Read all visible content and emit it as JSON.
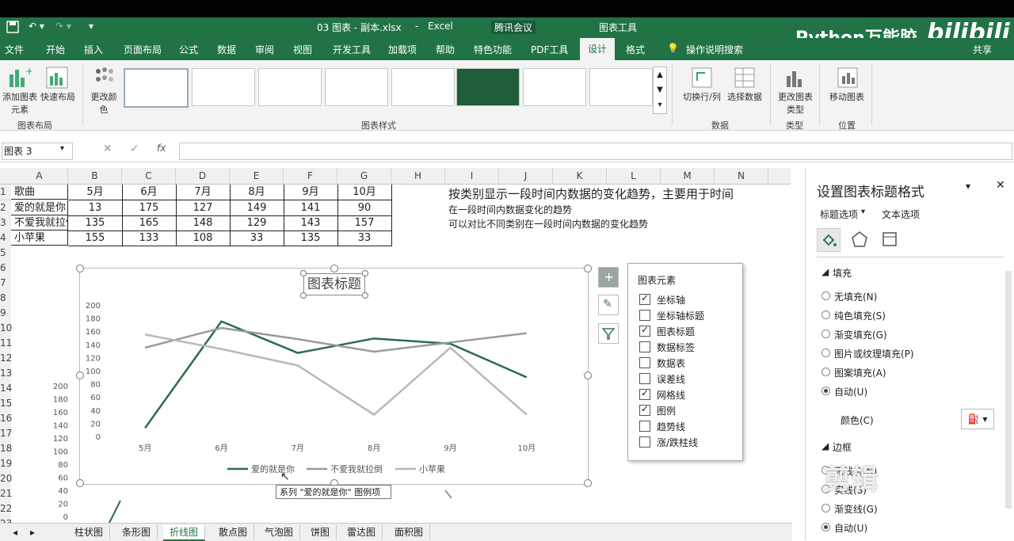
{
  "titlebar": {
    "filename": "03 图表 - 副本.xlsx",
    "app": "Excel",
    "meeting": "腾讯会议",
    "context_tab": "图表工具",
    "share": "共享"
  },
  "watermark": {
    "channel": "Python万能胶",
    "brand": "bilibili",
    "editor": "剪辑"
  },
  "ribbon_tabs": [
    "文件",
    "开始",
    "插入",
    "页面布局",
    "公式",
    "数据",
    "审阅",
    "视图",
    "开发工具",
    "加载项",
    "帮助",
    "特色功能",
    "PDF工具",
    "设计",
    "格式"
  ],
  "active_tab": "设计",
  "search_label": "操作说明搜索",
  "ribbon": {
    "add_element": "添加图表元素",
    "quick_layout": "快速布局",
    "group_layout": "图表布局",
    "change_colors": "更改颜色",
    "group_styles": "图表样式",
    "switch_rowcol": "切换行/列",
    "select_data": "选择数据",
    "group_data": "数据",
    "change_type": "更改图表类型",
    "group_type": "类型",
    "move_chart": "移动图表",
    "group_location": "位置"
  },
  "namebox": "图表 3",
  "fx": "fx",
  "columns": [
    "A",
    "B",
    "C",
    "D",
    "E",
    "F",
    "G",
    "H",
    "I",
    "J",
    "K",
    "L",
    "M",
    "N"
  ],
  "rows": [
    "1",
    "2",
    "3",
    "4",
    "5",
    "6",
    "7",
    "8",
    "9",
    "10",
    "11",
    "12",
    "13",
    "14",
    "15",
    "16",
    "17",
    "18",
    "19",
    "20",
    "21",
    "22",
    "23"
  ],
  "table": {
    "header": [
      "歌曲",
      "5月",
      "6月",
      "7月",
      "8月",
      "9月",
      "10月"
    ],
    "rows": [
      [
        "爱的就是你",
        "13",
        "175",
        "127",
        "149",
        "141",
        "90"
      ],
      [
        "不爱我就拉倒",
        "135",
        "165",
        "148",
        "129",
        "143",
        "157"
      ],
      [
        "小苹果",
        "155",
        "133",
        "108",
        "33",
        "135",
        "33"
      ]
    ]
  },
  "notes": [
    "按类别显示一段时间内数据的变化趋势，主要用于时间",
    "在一段时间内数据变化的趋势",
    "可以对比不同类别在一段时间内数据的变化趋势"
  ],
  "chart_data": {
    "type": "line",
    "title": "图表标题",
    "categories": [
      "5月",
      "6月",
      "7月",
      "8月",
      "9月",
      "10月"
    ],
    "ylim": [
      0,
      200
    ],
    "yticks": [
      "0",
      "20",
      "40",
      "60",
      "80",
      "100",
      "120",
      "140",
      "160",
      "180",
      "200"
    ],
    "grid": false,
    "legend": "bottom",
    "series": [
      {
        "name": "爱的就是你",
        "values": [
          13,
          175,
          127,
          149,
          141,
          90
        ],
        "color": "#2e6b47"
      },
      {
        "name": "不爱我就拉倒",
        "values": [
          135,
          165,
          148,
          129,
          143,
          157
        ],
        "color": "#9a9a9a"
      },
      {
        "name": "小苹果",
        "values": [
          155,
          133,
          108,
          33,
          135,
          33
        ],
        "color": "#b8b8b8"
      }
    ]
  },
  "behind_chart_yticks": [
    "0",
    "20",
    "40",
    "60",
    "80",
    "100",
    "120",
    "140",
    "160",
    "180",
    "200"
  ],
  "chart_elements": {
    "title": "图表元素",
    "items": [
      {
        "label": "坐标轴",
        "checked": true
      },
      {
        "label": "坐标轴标题",
        "checked": false
      },
      {
        "label": "图表标题",
        "checked": true
      },
      {
        "label": "数据标签",
        "checked": false
      },
      {
        "label": "数据表",
        "checked": false
      },
      {
        "label": "误差线",
        "checked": false
      },
      {
        "label": "网格线",
        "checked": true
      },
      {
        "label": "图例",
        "checked": true
      },
      {
        "label": "趋势线",
        "checked": false
      },
      {
        "label": "涨/跌柱线",
        "checked": false
      }
    ]
  },
  "tooltip": "系列 \"爱的就是你\" 图例项",
  "pane": {
    "title": "设置图表标题格式",
    "tab_title_options": "标题选项",
    "tab_text_options": "文本选项",
    "fill_section": "填充",
    "fill_options": [
      {
        "label": "无填充(N)",
        "selected": false
      },
      {
        "label": "纯色填充(S)",
        "selected": false
      },
      {
        "label": "渐变填充(G)",
        "selected": false
      },
      {
        "label": "图片或纹理填充(P)",
        "selected": false
      },
      {
        "label": "图案填充(A)",
        "selected": false
      },
      {
        "label": "自动(U)",
        "selected": true
      }
    ],
    "color_label": "颜色(C)",
    "border_section": "边框",
    "border_options": [
      {
        "label": "无线条(N)",
        "selected": false
      },
      {
        "label": "实线(S)",
        "selected": false
      },
      {
        "label": "渐变线(G)",
        "selected": false
      },
      {
        "label": "自动(U)",
        "selected": true
      }
    ]
  },
  "sheet_tabs": [
    "柱状图",
    "条形图",
    "折线图",
    "散点图",
    "气泡图",
    "饼图",
    "雷达图",
    "面积图"
  ],
  "active_sheet": "折线图"
}
